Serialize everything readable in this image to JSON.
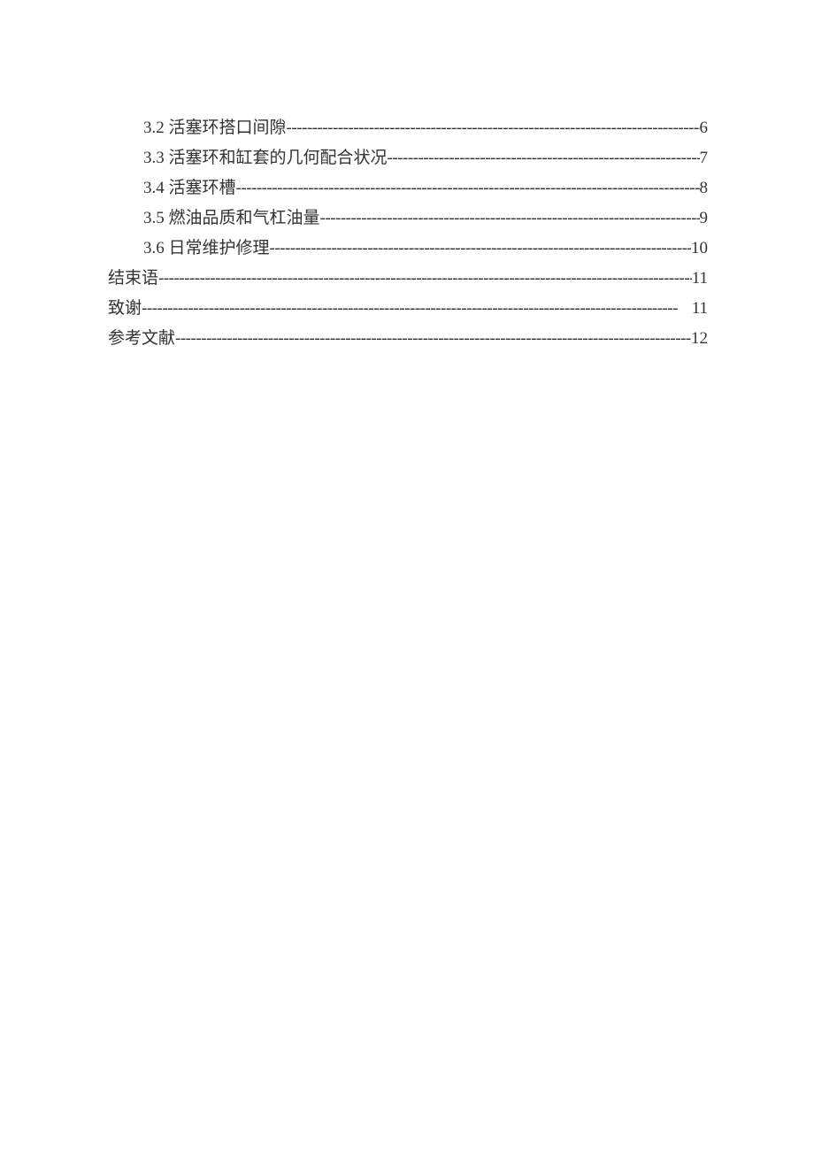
{
  "toc": {
    "entries": [
      {
        "level": 2,
        "label": "3.2 活塞环搭口间隙",
        "page": "6"
      },
      {
        "level": 2,
        "label": "3.3 活塞环和缸套的几何配合状况",
        "page": "7"
      },
      {
        "level": 2,
        "label": "3.4 活塞环槽",
        "page": "8"
      },
      {
        "level": 2,
        "label": "3.5 燃油品质和气杠油量",
        "page": "9"
      },
      {
        "level": 2,
        "label": "3.6 日常维护修理",
        "page": "10"
      },
      {
        "level": 1,
        "label": "结束语",
        "page": "11"
      },
      {
        "level": 1,
        "label": "致谢",
        "page": "11"
      },
      {
        "level": 1,
        "label": "参考文献",
        "page": "12"
      }
    ]
  },
  "leader": "--------------------------------------------------------------------------------------------------------"
}
